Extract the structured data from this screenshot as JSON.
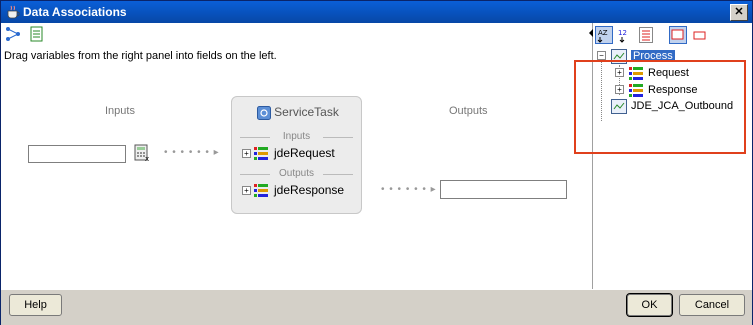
{
  "window": {
    "title": "Data Associations",
    "close_glyph": "✕"
  },
  "toolbar": {
    "icons": [
      "mapping-icon",
      "document-icon"
    ]
  },
  "hint": "Drag variables from the right panel into fields on the left.",
  "left": {
    "inputs_label": "Inputs",
    "outputs_label": "Outputs"
  },
  "service_task": {
    "title": "ServiceTask",
    "inputs_section": "Inputs",
    "outputs_section": "Outputs",
    "input_var": "jdeRequest",
    "output_var": "jdeResponse"
  },
  "tree": {
    "root": "Process",
    "children": [
      "Request",
      "Response"
    ],
    "sibling": "JDE_JCA_Outbound"
  },
  "buttons": {
    "help": "Help",
    "ok": "OK",
    "cancel": "Cancel"
  },
  "colors": {
    "highlight_box": "#e0401c",
    "selection": "#316ac5"
  }
}
